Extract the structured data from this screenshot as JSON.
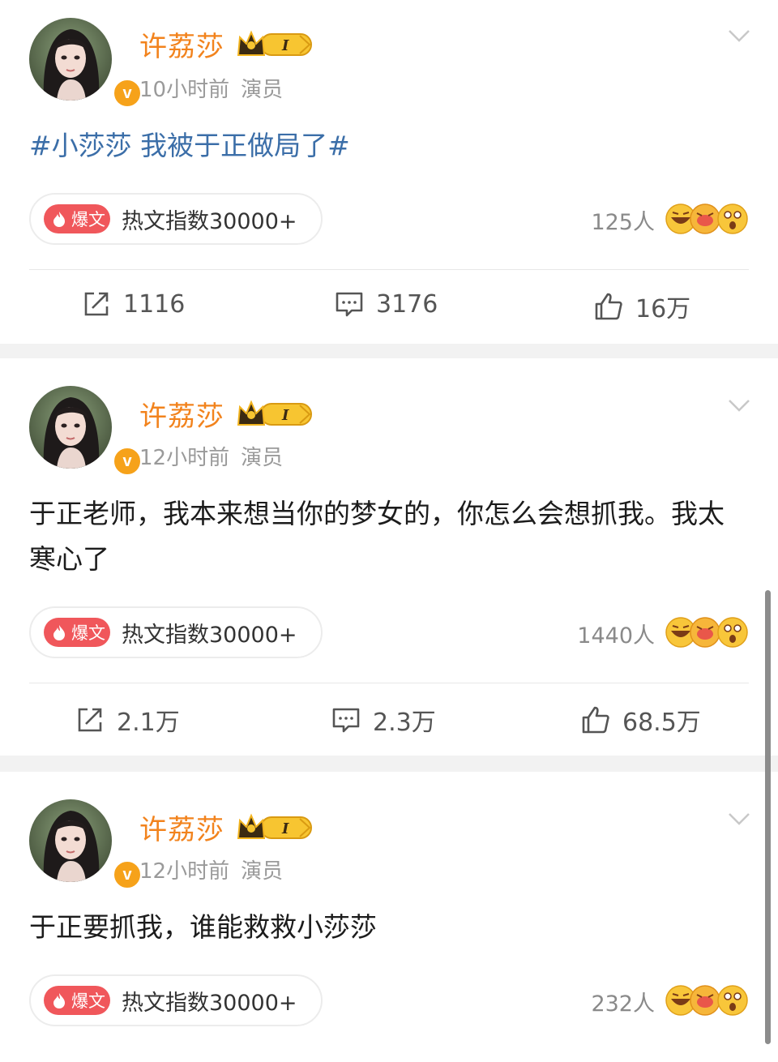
{
  "posts": [
    {
      "author": "许荔莎",
      "vip_level": "I",
      "avatar_badge": "v",
      "time": "10小时前",
      "source": "演员",
      "text": "#小莎莎 我被于正做局了#",
      "is_topic": true,
      "hot_badge": "爆文",
      "hot_text": "热文指数30000+",
      "reaction_count": "125人",
      "reposts": "1116",
      "comments": "3176",
      "likes": "16万"
    },
    {
      "author": "许荔莎",
      "vip_level": "I",
      "avatar_badge": "v",
      "time": "12小时前",
      "source": "演员",
      "text": "于正老师，我本来想当你的梦女的，你怎么会想抓我。我太寒心了",
      "is_topic": false,
      "hot_badge": "爆文",
      "hot_text": "热文指数30000+",
      "reaction_count": "1440人",
      "reposts": "2.1万",
      "comments": "2.3万",
      "likes": "68.5万"
    },
    {
      "author": "许荔莎",
      "vip_level": "I",
      "avatar_badge": "v",
      "time": "12小时前",
      "source": "演员",
      "text": "于正要抓我，谁能救救小莎莎",
      "is_topic": false,
      "hot_badge": "爆文",
      "hot_text": "热文指数30000+",
      "reaction_count": "232人"
    }
  ],
  "icons": {
    "repost": "repost-icon",
    "comment": "comment-icon",
    "like": "thumbs-up-icon",
    "more": "chevron-down-icon",
    "vip": "crown-vip-badge-icon",
    "reactions": "laugh-cry-surprised-emoji-icons"
  },
  "colors": {
    "author_name": "#f2831d",
    "topic_link": "#3b6ea8",
    "hot_badge": "#f0575b",
    "verified_badge": "#f6a21a",
    "meta_text": "#9a9a9a"
  }
}
